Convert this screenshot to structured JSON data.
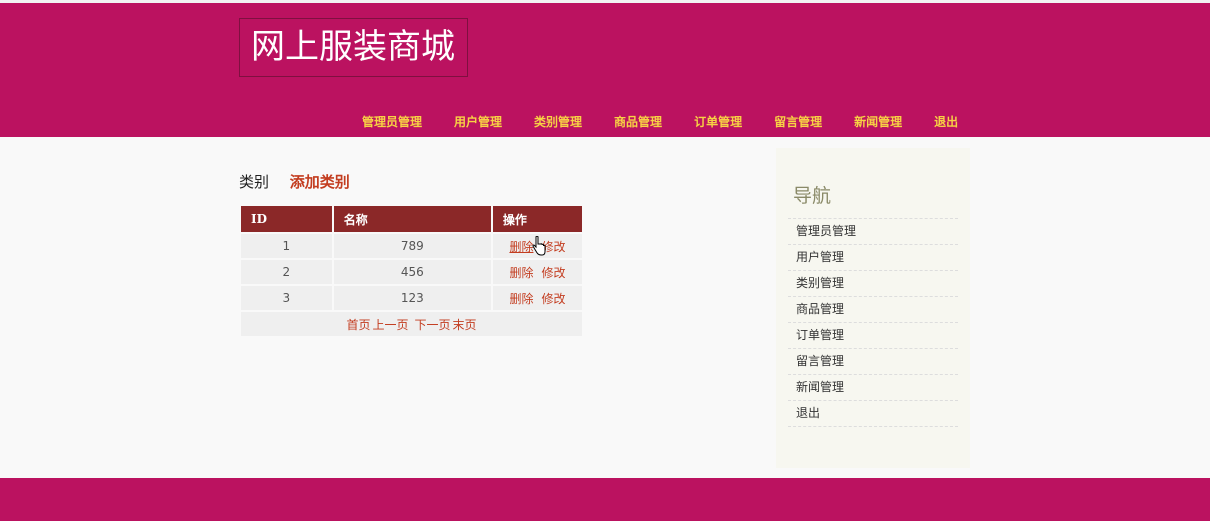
{
  "header": {
    "logo": "网上服装商城",
    "nav": [
      "管理员管理",
      "用户管理",
      "类别管理",
      "商品管理",
      "订单管理",
      "留言管理",
      "新闻管理",
      "退出"
    ]
  },
  "content": {
    "section_label": "类别",
    "add_link": "添加类别",
    "table": {
      "headers": [
        "ID",
        "名称",
        "操作"
      ],
      "rows": [
        {
          "id": "1",
          "name": "789"
        },
        {
          "id": "2",
          "name": "456"
        },
        {
          "id": "3",
          "name": "123"
        }
      ],
      "delete_label": "删除",
      "edit_label": "修改"
    },
    "pager": [
      "首页",
      "上一页",
      "下一页",
      "末页"
    ]
  },
  "sidebar": {
    "title": "导航",
    "items": [
      "管理员管理",
      "用户管理",
      "类别管理",
      "商品管理",
      "订单管理",
      "留言管理",
      "新闻管理",
      "退出"
    ]
  },
  "colors": {
    "header_bg": "#bb1260",
    "nav_text": "#f7d244",
    "table_header_bg": "#8b2828",
    "link": "#c33d20"
  },
  "icons": {
    "cursor": "hand-pointer-icon"
  }
}
